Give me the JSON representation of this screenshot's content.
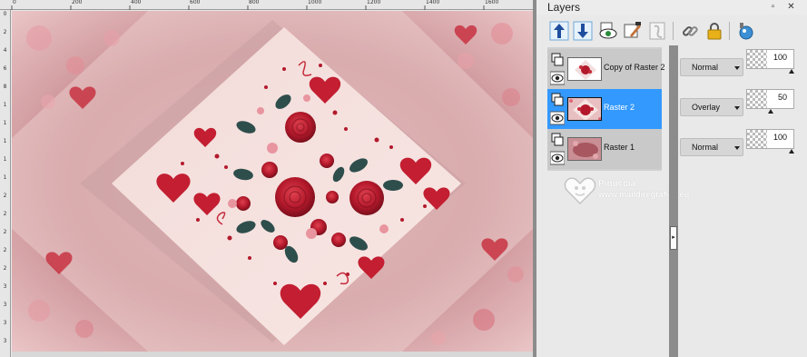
{
  "ruler": {
    "top_ticks": [
      "0",
      "200",
      "400",
      "600",
      "800",
      "1000",
      "1200",
      "1400",
      "1600"
    ],
    "left_ticks": [
      "0",
      "2",
      "4",
      "6",
      "8",
      "1",
      "1",
      "1",
      "1",
      "1",
      "2",
      "2",
      "2",
      "2",
      "2",
      "3",
      "3",
      "3",
      "3"
    ]
  },
  "canvas": {
    "description_colors": {
      "rose": "#b8192b",
      "leaf": "#2e4e4c",
      "pink": "#e8b7ba",
      "panel": "#f1d7d6"
    }
  },
  "panel": {
    "title": "Layers",
    "head_buttons": [
      {
        "icon": "maximize-icon",
        "glyph": "▫"
      },
      {
        "icon": "close-icon",
        "glyph": "✕"
      }
    ],
    "toolbar": [
      {
        "icon": "move-layer-up-icon"
      },
      {
        "icon": "move-layer-down-icon"
      },
      {
        "icon": "layer-visibility-icon"
      },
      {
        "icon": "edit-selection-icon"
      },
      {
        "icon": "link-layers-icon"
      },
      {
        "icon": "lock-transparency-icon"
      },
      {
        "icon": "layer-options-icon"
      }
    ],
    "layers": [
      {
        "name": "Copy of Raster 2",
        "blend_mode": "Normal",
        "opacity": "100",
        "selected": false
      },
      {
        "name": "Raster 2",
        "blend_mode": "Overlay",
        "opacity": "50",
        "selected": true
      },
      {
        "name": "Raster 1",
        "blend_mode": "Normal",
        "opacity": "100",
        "selected": false
      }
    ],
    "splitter_glyph": "▸",
    "selection_color": "#3399ff",
    "watermark": {
      "brand": "Pinuccia",
      "url": "www.maildiregrafica.eu"
    }
  }
}
